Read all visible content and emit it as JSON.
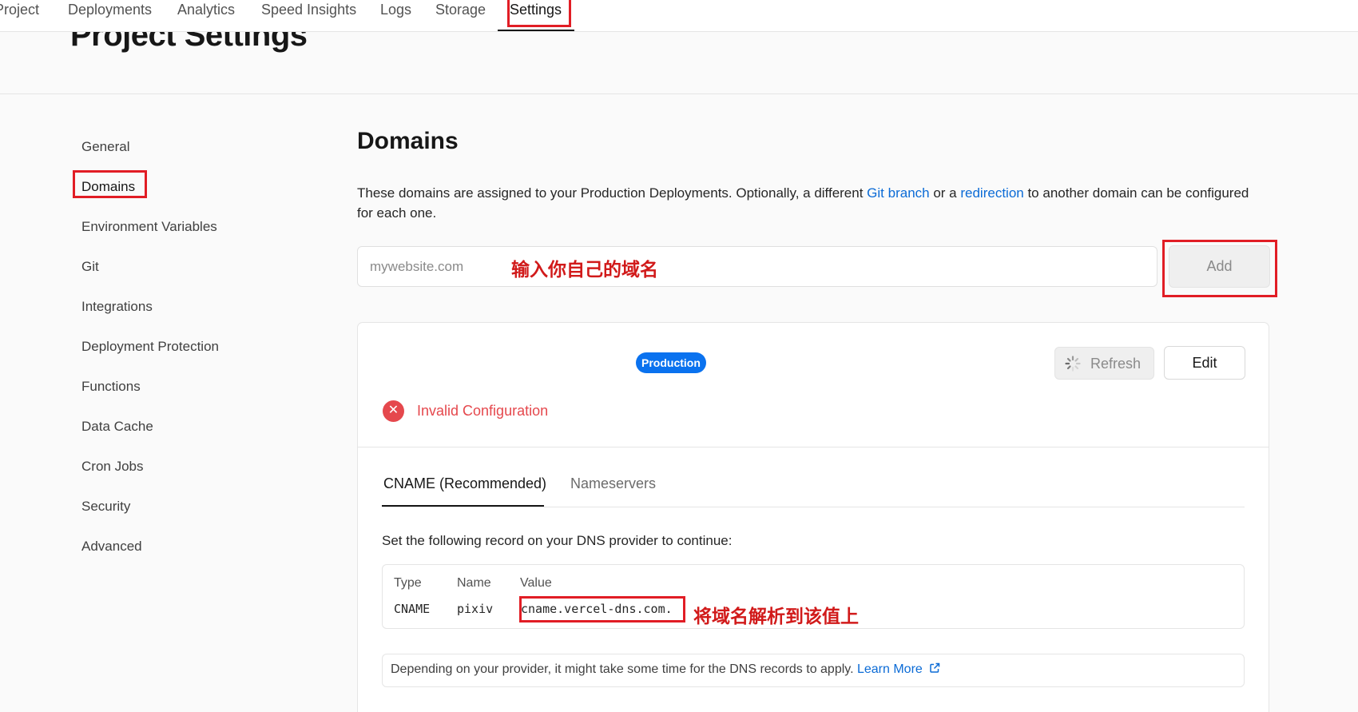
{
  "topnav": {
    "tabs": [
      {
        "label": "Project"
      },
      {
        "label": "Deployments"
      },
      {
        "label": "Analytics"
      },
      {
        "label": "Speed Insights"
      },
      {
        "label": "Logs"
      },
      {
        "label": "Storage"
      },
      {
        "label": "Settings",
        "active": true
      }
    ]
  },
  "header": {
    "title": "Project Settings"
  },
  "sidebar": {
    "items": [
      {
        "label": "General"
      },
      {
        "label": "Domains",
        "active": true
      },
      {
        "label": "Environment Variables"
      },
      {
        "label": "Git"
      },
      {
        "label": "Integrations"
      },
      {
        "label": "Deployment Protection"
      },
      {
        "label": "Functions"
      },
      {
        "label": "Data Cache"
      },
      {
        "label": "Cron Jobs"
      },
      {
        "label": "Security"
      },
      {
        "label": "Advanced"
      }
    ]
  },
  "domains": {
    "title": "Domains",
    "desc_part1": "These domains are assigned to your Production Deployments. Optionally, a different ",
    "desc_link1": "Git branch",
    "desc_part2": " or a ",
    "desc_link2": "redirection",
    "desc_part3": " to another domain can be configured for each one.",
    "input_placeholder": "mywebsite.com",
    "input_value": "",
    "input_annotation": "输入你自己的域名",
    "add_label": "Add"
  },
  "domain_card": {
    "badge": "Production",
    "refresh_label": "Refresh",
    "edit_label": "Edit",
    "error_text": "Invalid Configuration",
    "tabs": [
      {
        "label": "CNAME (Recommended)",
        "active": true
      },
      {
        "label": "Nameservers"
      }
    ],
    "instructions": "Set the following record on your DNS provider to continue:",
    "record_headers": {
      "type": "Type",
      "name": "Name",
      "value": "Value"
    },
    "record": {
      "type": "CNAME",
      "name": "pixiv",
      "value": "cname.vercel-dns.com."
    },
    "record_annotation": "将域名解析到该值上",
    "note_text": "Depending on your provider, it might take some time for the DNS records to apply. ",
    "note_link": "Learn More"
  },
  "colors": {
    "accent_blue": "#0a72ef",
    "link_blue": "#0b6bd6",
    "error_red": "#e5484d",
    "annotation_red": "#e11d25"
  }
}
